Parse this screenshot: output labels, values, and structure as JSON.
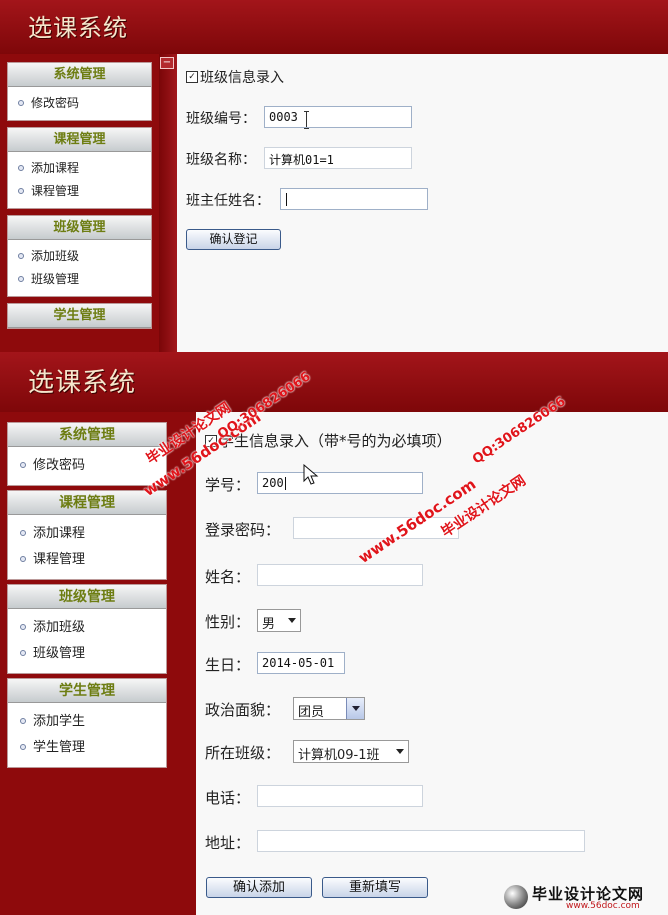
{
  "screen1": {
    "app_title": "选课系统",
    "sidebar": [
      {
        "header": "系统管理",
        "items": [
          "修改密码"
        ]
      },
      {
        "header": "课程管理",
        "items": [
          "添加课程",
          "课程管理"
        ]
      },
      {
        "header": "班级管理",
        "items": [
          "添加班级",
          "班级管理"
        ]
      },
      {
        "header": "学生管理",
        "items": []
      }
    ],
    "collapse_symbol": "−",
    "form_title": "班级信息录入",
    "fields": {
      "class_no": {
        "label": "班级编号：",
        "value": "0003"
      },
      "class_name": {
        "label": "班级名称：",
        "value": "计算机01=1"
      },
      "teacher_name": {
        "label": "班主任姓名：",
        "value": ""
      }
    },
    "submit_label": "确认登记"
  },
  "screen2": {
    "app_title": "选课系统",
    "sidebar": [
      {
        "header": "系统管理",
        "items": [
          "修改密码"
        ]
      },
      {
        "header": "课程管理",
        "items": [
          "添加课程",
          "课程管理"
        ]
      },
      {
        "header": "班级管理",
        "items": [
          "添加班级",
          "班级管理"
        ]
      },
      {
        "header": "学生管理",
        "items": [
          "添加学生",
          "学生管理"
        ]
      }
    ],
    "form_title": "学生信息录入（带*号的为必填项）",
    "fields": {
      "student_no": {
        "label": "学号：",
        "value": "200"
      },
      "password": {
        "label": "登录密码：",
        "value": ""
      },
      "name": {
        "label": "姓名：",
        "value": ""
      },
      "gender": {
        "label": "性别：",
        "value": "男"
      },
      "birthday": {
        "label": "生日：",
        "value": "2014-05-01"
      },
      "political": {
        "label": "政治面貌：",
        "value": "团员"
      },
      "class": {
        "label": "所在班级：",
        "value": "计算机09-1班"
      },
      "phone": {
        "label": "电话：",
        "value": ""
      },
      "address": {
        "label": "地址：",
        "value": ""
      }
    },
    "add_label": "确认添加",
    "reset_label": "重新填写"
  },
  "watermarks": {
    "site_name": "毕业设计论文网",
    "site_url": "www.56doc.com",
    "qq": "QQ:306826066"
  },
  "corner_logo": {
    "text": "毕业设计论文网",
    "url": "www.56doc.com"
  },
  "colors": {
    "header_red": "#8e0a0c",
    "title_text": "#f6e6cc",
    "menu_header_text": "#6d7d12",
    "watermark": "#e0151b"
  }
}
